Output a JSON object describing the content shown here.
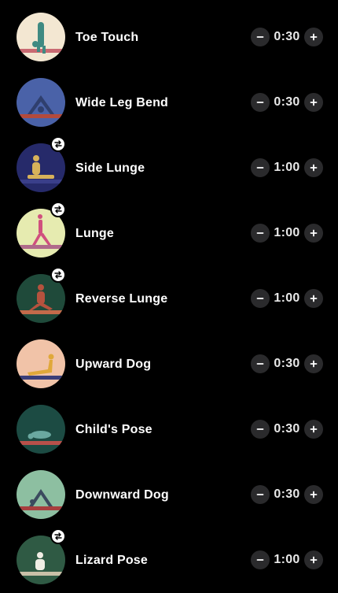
{
  "exercises": [
    {
      "name": "Toe Touch",
      "duration": "0:30",
      "swap": false,
      "bg": "#f3e7d2",
      "mat": "#c96a72",
      "pose": "fold",
      "figure": "#3f8a82"
    },
    {
      "name": "Wide Leg Bend",
      "duration": "0:30",
      "swap": false,
      "bg": "#4a62a8",
      "mat": "#b34a3c",
      "pose": "wide",
      "figure": "#2f3f6e"
    },
    {
      "name": "Side Lunge",
      "duration": "1:00",
      "swap": true,
      "bg": "#262a6a",
      "mat": "#3a3f8a",
      "pose": "side",
      "figure": "#d7b25a"
    },
    {
      "name": "Lunge",
      "duration": "1:00",
      "swap": true,
      "bg": "#e6ebb0",
      "mat": "#b06a8a",
      "pose": "lunge",
      "figure": "#d0507e"
    },
    {
      "name": "Reverse Lunge",
      "duration": "1:00",
      "swap": true,
      "bg": "#1f4a3a",
      "mat": "#c46a4a",
      "pose": "revlunge",
      "figure": "#b5523e"
    },
    {
      "name": "Upward Dog",
      "duration": "0:30",
      "swap": false,
      "bg": "#f1c3a8",
      "mat": "#3b3f7a",
      "pose": "updog",
      "figure": "#e0a83a"
    },
    {
      "name": "Child's Pose",
      "duration": "0:30",
      "swap": false,
      "bg": "#1c4b43",
      "mat": "#b8504a",
      "pose": "child",
      "figure": "#6aa8a0"
    },
    {
      "name": "Downward Dog",
      "duration": "0:30",
      "swap": false,
      "bg": "#8dbfa1",
      "mat": "#a83e3e",
      "pose": "downdog",
      "figure": "#3b4a5e"
    },
    {
      "name": "Lizard Pose",
      "duration": "1:00",
      "swap": true,
      "bg": "#2f5a44",
      "mat": "#c9c0a8",
      "pose": "lizard",
      "figure": "#f0ede4"
    }
  ],
  "icons": {
    "minus": "minus-icon",
    "plus": "plus-icon",
    "swap": "swap-icon"
  }
}
